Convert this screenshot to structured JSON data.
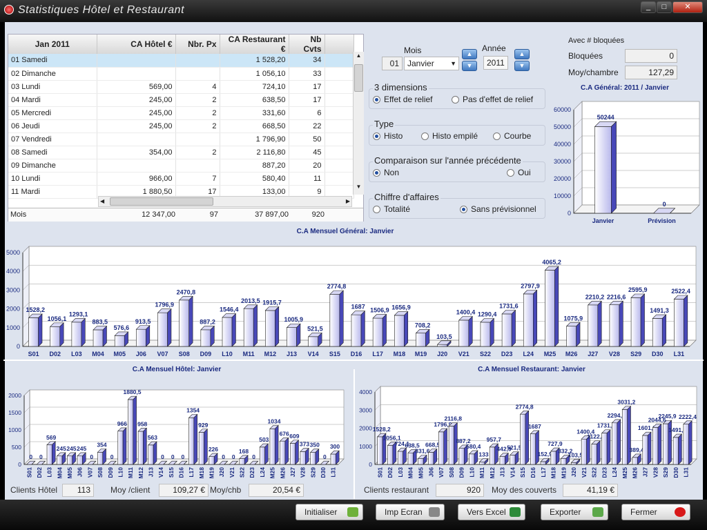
{
  "window": {
    "title": "Statistiques Hôtel et Restaurant"
  },
  "grid": {
    "headers": [
      "Jan 2011",
      "CA Hôtel €",
      "Nbr. Px",
      "CA Restaurant €",
      "Nb Cvts"
    ],
    "rows": [
      [
        "01  Samedi",
        "",
        "",
        "1 528,20",
        "34"
      ],
      [
        "02  Dimanche",
        "",
        "",
        "1 056,10",
        "33"
      ],
      [
        "03  Lundi",
        "569,00",
        "4",
        "724,10",
        "17"
      ],
      [
        "04  Mardi",
        "245,00",
        "2",
        "638,50",
        "17"
      ],
      [
        "05  Mercredi",
        "245,00",
        "2",
        "331,60",
        "6"
      ],
      [
        "06  Jeudi",
        "245,00",
        "2",
        "668,50",
        "22"
      ],
      [
        "07  Vendredi",
        "",
        "",
        "1 796,90",
        "50"
      ],
      [
        "08  Samedi",
        "354,00",
        "2",
        "2 116,80",
        "45"
      ],
      [
        "09  Dimanche",
        "",
        "",
        "887,20",
        "20"
      ],
      [
        "10  Lundi",
        "966,00",
        "7",
        "580,40",
        "11"
      ],
      [
        "11  Mardi",
        "1 880,50",
        "17",
        "133,00",
        "9"
      ]
    ],
    "footer": {
      "label": "Mois",
      "ca_hotel": "12 347,00",
      "nbr_px": "97",
      "ca_restaurant": "37 897,00",
      "nb_cvts": "920"
    }
  },
  "period": {
    "mois_label": "Mois",
    "mois_num": "01",
    "mois_value": "Janvier",
    "annee_label": "Année",
    "annee_value": "2011"
  },
  "bloquees": {
    "header": "Avec # bloquées",
    "bloquees_label": "Bloquées",
    "bloquees_value": "0",
    "moy_label": "Moy/chambre",
    "moy_value": "127,29"
  },
  "options": {
    "dimensions": {
      "title": "3 dimensions",
      "opt1": "Effet de relief",
      "opt2": "Pas d'effet de relief",
      "selected": 1
    },
    "type": {
      "title": "Type",
      "opt1": "Histo",
      "opt2": "Histo empilé",
      "opt3": "Courbe",
      "selected": 1
    },
    "comparaison": {
      "title": "Comparaison sur l'année précédente",
      "opt1": "Non",
      "opt2": "Oui",
      "selected": 1
    },
    "chiffre": {
      "title": "Chiffre d'affaires",
      "opt1": "Totalité",
      "opt2": "Sans prévisionnel",
      "selected": 2
    }
  },
  "stats": {
    "clients_hotel_label": "Clients Hôtel",
    "clients_hotel_value": "113",
    "moy_client_label": "Moy /client",
    "moy_client_value": "109,27 €",
    "moy_chb_label": "Moy/chb",
    "moy_chb_value": "20,54 €",
    "clients_resto_label": "Clients restaurant",
    "clients_resto_value": "920",
    "moy_couverts_label": "Moy des couverts",
    "moy_couverts_value": "41,19 €"
  },
  "buttons": {
    "initialiser": "Initialiser",
    "imp_ecran": "Imp Ecran",
    "vers_excel": "Vers Excel",
    "exporter": "Exporter",
    "fermer": "Fermer"
  },
  "chart_data": [
    {
      "type": "bar",
      "title": "C.A  Général: 2011 / Janvier",
      "categories": [
        "Janvier",
        "Prévision"
      ],
      "values": [
        50244,
        0
      ],
      "ylim": [
        0,
        60000
      ],
      "yticks": [
        0,
        10000,
        20000,
        30000,
        40000,
        50000,
        60000
      ],
      "grid": true,
      "color": "#5555cc"
    },
    {
      "type": "bar",
      "title": "C.A Mensuel Général: Janvier",
      "categories": [
        "S01",
        "D02",
        "L03",
        "M04",
        "M05",
        "J06",
        "V07",
        "S08",
        "D09",
        "L10",
        "M11",
        "M12",
        "J13",
        "V14",
        "S15",
        "D16",
        "L17",
        "M18",
        "M19",
        "J20",
        "V21",
        "S22",
        "D23",
        "L24",
        "M25",
        "M26",
        "J27",
        "V28",
        "S29",
        "D30",
        "L31"
      ],
      "values": [
        1528.2,
        1056.1,
        1293.1,
        883.5,
        576.6,
        913.5,
        1796.9,
        2470.8,
        887.2,
        1546.4,
        2013.5,
        1915.7,
        1005.9,
        521.5,
        2774.8,
        1687,
        1506.9,
        1656.9,
        708.2,
        103.5,
        1400.4,
        1290.4,
        1731.6,
        2797.9,
        4065.2,
        1075.9,
        2210.2,
        2216.6,
        2595.9,
        1491.3,
        2522.4
      ],
      "labels": [
        "1528,2",
        "1056,1",
        "1293,1",
        "883,5",
        "576,6",
        "913,5",
        "1796,9",
        "2470,8",
        "887,2",
        "1546,4",
        "2013,5",
        "1915,7",
        "1005,9",
        "521,5",
        "2774,8",
        "1687",
        "1506,9",
        "1656,9",
        "708,2",
        "103,5",
        "1400,4",
        "1290,4",
        "1731,6",
        "2797,9",
        "4065,2",
        "1075,9",
        "2210,2",
        "2216,6",
        "2595,9",
        "1491,3",
        "2522,4"
      ],
      "ylim": [
        0,
        5000
      ],
      "yticks": [
        0,
        1000,
        2000,
        3000,
        4000,
        5000
      ],
      "grid": true,
      "color": "#5555cc"
    },
    {
      "type": "bar",
      "title": "C.A Mensuel Hôtel: Janvier",
      "categories": [
        "S01",
        "D02",
        "L03",
        "M04",
        "M05",
        "J06",
        "V07",
        "S08",
        "D09",
        "L10",
        "M11",
        "M12",
        "J13",
        "V14",
        "S15",
        "D16",
        "L17",
        "M18",
        "M19",
        "J20",
        "V21",
        "S22",
        "D23",
        "L24",
        "M25",
        "M26",
        "J27",
        "V28",
        "S29",
        "D30",
        "L31"
      ],
      "values": [
        0,
        0,
        569,
        245,
        245,
        245,
        0,
        354,
        0,
        966,
        1880.5,
        958,
        563,
        0,
        0,
        0,
        1354,
        929,
        226,
        0,
        0,
        168,
        0,
        503,
        1034,
        676,
        609,
        373,
        350,
        0,
        300
      ],
      "labels": [
        "0",
        "0",
        "569",
        "245",
        "245",
        "245",
        "0",
        "354",
        "0",
        "966",
        "1880,5",
        "958",
        "563",
        "0",
        "0",
        "0",
        "1354",
        "929",
        "226",
        "0",
        "0",
        "168",
        "0",
        "503",
        "1034",
        "676",
        "609",
        "373",
        "350",
        "0",
        "300"
      ],
      "ylim": [
        0,
        2000
      ],
      "yticks": [
        0,
        500,
        1000,
        1500,
        2000
      ],
      "grid": true,
      "color": "#5555cc"
    },
    {
      "type": "bar",
      "title": "C.A Mensuel Restaurant: Janvier",
      "categories": [
        "S01",
        "D02",
        "L03",
        "M04",
        "M05",
        "J06",
        "V07",
        "S08",
        "D09",
        "L10",
        "M11",
        "M12",
        "J13",
        "V14",
        "S15",
        "D16",
        "L17",
        "M18",
        "M19",
        "J20",
        "V21",
        "S22",
        "D23",
        "L24",
        "M25",
        "M26",
        "J27",
        "V28",
        "S29",
        "D30",
        "L31"
      ],
      "values": [
        1528.2,
        1056.1,
        724.1,
        638.5,
        331.6,
        668.5,
        1796.9,
        2116.8,
        887.2,
        580.4,
        133,
        957.7,
        442.9,
        521.5,
        2774.8,
        1687,
        152.9,
        727.9,
        332.2,
        103.5,
        1400.4,
        1122.4,
        1731.6,
        2294.8,
        3031.2,
        389.4,
        1601.2,
        2044.6,
        2245.9,
        1491.3,
        2222.4
      ],
      "labels": [
        "1528,2",
        "1056,1",
        "724,1",
        "638,5",
        "331,6",
        "668,5",
        "1796,9",
        "2116,8",
        "887,2",
        "580,4",
        "133",
        "957,7",
        "442,9",
        "521,5",
        "2774,8",
        "1687",
        "152,9",
        "727,9",
        "332,2",
        "103,5",
        "1400,4",
        "1122,4",
        "1731,6",
        "2294,8",
        "3031,2",
        "389,4",
        "1601,2",
        "2044,6",
        "2245,9",
        "1491,3",
        "2222,4"
      ],
      "ylim": [
        0,
        4000
      ],
      "yticks": [
        0,
        1000,
        2000,
        3000,
        4000
      ],
      "grid": true,
      "color": "#5555cc"
    }
  ]
}
